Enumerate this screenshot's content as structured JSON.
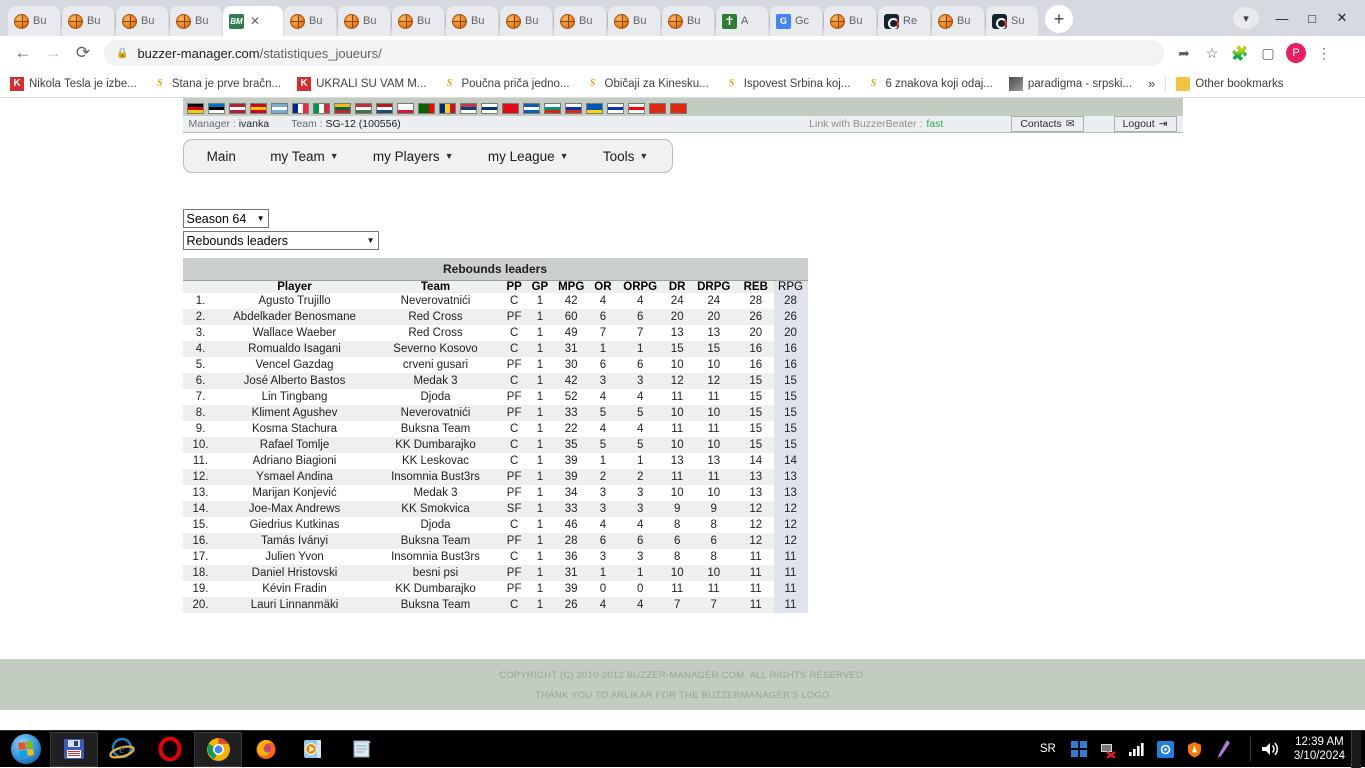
{
  "browser": {
    "tabs": [
      {
        "label": "Bu",
        "icon": "basketball-icon",
        "active": false
      },
      {
        "label": "Bu",
        "icon": "basketball-icon",
        "active": false
      },
      {
        "label": "Bu",
        "icon": "basketball-icon",
        "active": false
      },
      {
        "label": "Bu",
        "icon": "basketball-icon",
        "active": false
      },
      {
        "label": "",
        "icon": "bm-logo-icon",
        "active": true
      },
      {
        "label": "Bu",
        "icon": "basketball-icon",
        "active": false
      },
      {
        "label": "Bu",
        "icon": "basketball-icon",
        "active": false
      },
      {
        "label": "Bu",
        "icon": "basketball-icon",
        "active": false
      },
      {
        "label": "Bu",
        "icon": "basketball-icon",
        "active": false
      },
      {
        "label": "Bu",
        "icon": "basketball-icon",
        "active": false
      },
      {
        "label": "Bu",
        "icon": "basketball-icon",
        "active": false
      },
      {
        "label": "Bu",
        "icon": "basketball-icon",
        "active": false
      },
      {
        "label": "Bu",
        "icon": "basketball-icon",
        "active": false
      },
      {
        "label": "A",
        "icon": "google-translate-icon",
        "active": false
      },
      {
        "label": "Gc",
        "icon": "google-docs-icon",
        "active": false
      },
      {
        "label": "Bu",
        "icon": "basketball-icon",
        "active": false
      },
      {
        "label": "Re",
        "icon": "dark-dial-icon",
        "active": false
      },
      {
        "label": "Bu",
        "icon": "basketball-icon",
        "active": false
      },
      {
        "label": "Su",
        "icon": "dark-dial-icon",
        "active": false
      }
    ],
    "new_tab_label": "+",
    "close_tab_label": "✕",
    "window_controls": {
      "minimize": "—",
      "maximize": "□",
      "close": "✕"
    },
    "nav": {
      "back": "←",
      "forward": "→",
      "reload": "⟳"
    },
    "omnibox": {
      "lock_icon": "lock-icon",
      "url_domain": "buzzer-manager.com",
      "url_path": "/statistiques_joueurs/"
    },
    "toolbar_icons": [
      "share-icon",
      "star-icon",
      "extensions-icon",
      "sidepanel-icon",
      "profile-avatar",
      "menu-icon"
    ],
    "avatar_letter": "P",
    "bookmarks": [
      {
        "label": "Nikola Tesla je izbe...",
        "icon": "kurir-icon"
      },
      {
        "label": "Stana je prve bračn...",
        "icon": "srbijadanas-icon"
      },
      {
        "label": "UKRALI SU VAM M...",
        "icon": "kurir-icon"
      },
      {
        "label": "Poučna priča jedno...",
        "icon": "srbijadanas-icon"
      },
      {
        "label": "Običaji za Kinesku...",
        "icon": "srbijadanas-icon"
      },
      {
        "label": "Ispovest Srbina koj...",
        "icon": "srbijadanas-icon"
      },
      {
        "label": "6 znakova koji odaj...",
        "icon": "srbijadanas-icon"
      },
      {
        "label": "paradigma - srpski...",
        "icon": "image-icon"
      }
    ],
    "bookmarks_overflow": "»",
    "other_bookmarks": {
      "label": "Other bookmarks",
      "icon": "folder-icon"
    }
  },
  "site": {
    "flags": [
      {
        "name": "germany",
        "colors": [
          "#000000",
          "#dd0000",
          "#ffce00"
        ],
        "dir": "h"
      },
      {
        "name": "estonia",
        "colors": [
          "#0072ce",
          "#000000",
          "#ffffff"
        ],
        "dir": "h"
      },
      {
        "name": "usa",
        "colors": [
          "#b22234",
          "#ffffff",
          "#b22234"
        ],
        "dir": "h"
      },
      {
        "name": "spain",
        "colors": [
          "#c60b1e",
          "#ffc400",
          "#c60b1e"
        ],
        "dir": "h"
      },
      {
        "name": "argentina",
        "colors": [
          "#74acdf",
          "#ffffff",
          "#74acdf"
        ],
        "dir": "h"
      },
      {
        "name": "france",
        "colors": [
          "#002395",
          "#ffffff",
          "#ed2939"
        ],
        "dir": "v"
      },
      {
        "name": "italy",
        "colors": [
          "#009246",
          "#ffffff",
          "#ce2b37"
        ],
        "dir": "v"
      },
      {
        "name": "lithuania",
        "colors": [
          "#fdb913",
          "#006a44",
          "#c1272d"
        ],
        "dir": "h"
      },
      {
        "name": "hungary",
        "colors": [
          "#ce2939",
          "#ffffff",
          "#477050"
        ],
        "dir": "h"
      },
      {
        "name": "netherlands",
        "colors": [
          "#ae1c28",
          "#ffffff",
          "#21468b"
        ],
        "dir": "h"
      },
      {
        "name": "poland",
        "colors": [
          "#ffffff",
          "#ffffff",
          "#dc143c"
        ],
        "dir": "h"
      },
      {
        "name": "portugal",
        "colors": [
          "#006600",
          "#006600",
          "#ff0000"
        ],
        "dir": "v"
      },
      {
        "name": "romania",
        "colors": [
          "#002b7f",
          "#fcd116",
          "#ce1126"
        ],
        "dir": "v"
      },
      {
        "name": "serbia",
        "colors": [
          "#c6363c",
          "#0c4076",
          "#ffffff"
        ],
        "dir": "h"
      },
      {
        "name": "finland",
        "colors": [
          "#ffffff",
          "#003580",
          "#ffffff"
        ],
        "dir": "h"
      },
      {
        "name": "turkey",
        "colors": [
          "#e30a17",
          "#e30a17",
          "#e30a17"
        ],
        "dir": "h"
      },
      {
        "name": "greece",
        "colors": [
          "#0d5eaf",
          "#ffffff",
          "#0d5eaf"
        ],
        "dir": "h"
      },
      {
        "name": "bulgaria",
        "colors": [
          "#ffffff",
          "#00966e",
          "#d62612"
        ],
        "dir": "h"
      },
      {
        "name": "russia",
        "colors": [
          "#ffffff",
          "#0039a6",
          "#d52b1e"
        ],
        "dir": "h"
      },
      {
        "name": "ukraine",
        "colors": [
          "#0057b7",
          "#0057b7",
          "#ffd700"
        ],
        "dir": "h"
      },
      {
        "name": "israel",
        "colors": [
          "#ffffff",
          "#0038b8",
          "#ffffff"
        ],
        "dir": "h"
      },
      {
        "name": "georgia",
        "colors": [
          "#ffffff",
          "#ff0000",
          "#ffffff"
        ],
        "dir": "h"
      },
      {
        "name": "china",
        "colors": [
          "#de2910",
          "#de2910",
          "#de2910"
        ],
        "dir": "h"
      },
      {
        "name": "china2",
        "colors": [
          "#de2910",
          "#de2910",
          "#de2910"
        ],
        "dir": "h"
      }
    ],
    "infobar": {
      "manager_label": "Manager :",
      "manager_name": "ivanka",
      "team_label": "Team :",
      "team_name": "SG-12 (100556)",
      "link_label": "Link with BuzzerBeater :",
      "link_value": "fast",
      "contacts_label": "Contacts",
      "contacts_icon": "envelope-icon",
      "logout_label": "Logout",
      "logout_icon": "logout-icon"
    },
    "nav_menu": [
      {
        "label": "Main",
        "has_arrow": false
      },
      {
        "label": "my Team",
        "has_arrow": true
      },
      {
        "label": "my Players",
        "has_arrow": true
      },
      {
        "label": "my League",
        "has_arrow": true
      },
      {
        "label": "Tools",
        "has_arrow": true
      }
    ],
    "arrow_glyph": "▼",
    "season_select": {
      "value": "Season 64"
    },
    "stat_select": {
      "value": "Rebounds leaders"
    },
    "footer": {
      "line1": "COPYRIGHT (C) 2010-2012 BUZZER-MANAGER.COM. ALL RIGHTS RESERVED.",
      "line2": "THANK YOU TO ARLIKAR FOR THE BUZZERMANAGER'S LOGO"
    }
  },
  "table": {
    "title": "Rebounds leaders",
    "columns": [
      "",
      "Player",
      "Team",
      "PP",
      "GP",
      "MPG",
      "OR",
      "ORPG",
      "DR",
      "DRPG",
      "REB",
      "RPG"
    ],
    "rows": [
      {
        "rank": "1.",
        "player": "Agusto Trujillo",
        "team": "Neverovatnići",
        "pp": "C",
        "gp": "1",
        "mpg": "42",
        "or": "4",
        "orpg": "4",
        "dr": "24",
        "drpg": "24",
        "reb": "28",
        "rpg": "28"
      },
      {
        "rank": "2.",
        "player": "Abdelkader Benosmane",
        "team": "Red Cross",
        "pp": "PF",
        "gp": "1",
        "mpg": "60",
        "or": "6",
        "orpg": "6",
        "dr": "20",
        "drpg": "20",
        "reb": "26",
        "rpg": "26"
      },
      {
        "rank": "3.",
        "player": "Wallace Waeber",
        "team": "Red Cross",
        "pp": "C",
        "gp": "1",
        "mpg": "49",
        "or": "7",
        "orpg": "7",
        "dr": "13",
        "drpg": "13",
        "reb": "20",
        "rpg": "20"
      },
      {
        "rank": "4.",
        "player": "Romualdo Isagani",
        "team": "Severno Kosovo",
        "pp": "C",
        "gp": "1",
        "mpg": "31",
        "or": "1",
        "orpg": "1",
        "dr": "15",
        "drpg": "15",
        "reb": "16",
        "rpg": "16"
      },
      {
        "rank": "5.",
        "player": "Vencel Gazdag",
        "team": "crveni gusari",
        "pp": "PF",
        "gp": "1",
        "mpg": "30",
        "or": "6",
        "orpg": "6",
        "dr": "10",
        "drpg": "10",
        "reb": "16",
        "rpg": "16"
      },
      {
        "rank": "6.",
        "player": "José Alberto Bastos",
        "team": "Medak 3",
        "pp": "C",
        "gp": "1",
        "mpg": "42",
        "or": "3",
        "orpg": "3",
        "dr": "12",
        "drpg": "12",
        "reb": "15",
        "rpg": "15"
      },
      {
        "rank": "7.",
        "player": "Lin Tingbang",
        "team": "Djoda",
        "pp": "PF",
        "gp": "1",
        "mpg": "52",
        "or": "4",
        "orpg": "4",
        "dr": "11",
        "drpg": "11",
        "reb": "15",
        "rpg": "15"
      },
      {
        "rank": "8.",
        "player": "Kliment Agushev",
        "team": "Neverovatnići",
        "pp": "PF",
        "gp": "1",
        "mpg": "33",
        "or": "5",
        "orpg": "5",
        "dr": "10",
        "drpg": "10",
        "reb": "15",
        "rpg": "15"
      },
      {
        "rank": "9.",
        "player": "Kosma Stachura",
        "team": "Buksna Team",
        "pp": "C",
        "gp": "1",
        "mpg": "22",
        "or": "4",
        "orpg": "4",
        "dr": "11",
        "drpg": "11",
        "reb": "15",
        "rpg": "15"
      },
      {
        "rank": "10.",
        "player": "Rafael Tomlje",
        "team": "KK Dumbarajko",
        "pp": "C",
        "gp": "1",
        "mpg": "35",
        "or": "5",
        "orpg": "5",
        "dr": "10",
        "drpg": "10",
        "reb": "15",
        "rpg": "15"
      },
      {
        "rank": "11.",
        "player": "Adriano Biagioni",
        "team": "KK Leskovac",
        "pp": "C",
        "gp": "1",
        "mpg": "39",
        "or": "1",
        "orpg": "1",
        "dr": "13",
        "drpg": "13",
        "reb": "14",
        "rpg": "14"
      },
      {
        "rank": "12.",
        "player": "Ysmael Andina",
        "team": "Insomnia Bust3rs",
        "pp": "PF",
        "gp": "1",
        "mpg": "39",
        "or": "2",
        "orpg": "2",
        "dr": "11",
        "drpg": "11",
        "reb": "13",
        "rpg": "13"
      },
      {
        "rank": "13.",
        "player": "Marijan Konjević",
        "team": "Medak 3",
        "pp": "PF",
        "gp": "1",
        "mpg": "34",
        "or": "3",
        "orpg": "3",
        "dr": "10",
        "drpg": "10",
        "reb": "13",
        "rpg": "13"
      },
      {
        "rank": "14.",
        "player": "Joe-Max Andrews",
        "team": "KK Smokvica",
        "pp": "SF",
        "gp": "1",
        "mpg": "33",
        "or": "3",
        "orpg": "3",
        "dr": "9",
        "drpg": "9",
        "reb": "12",
        "rpg": "12"
      },
      {
        "rank": "15.",
        "player": "Giedrius Kutkinas",
        "team": "Djoda",
        "pp": "C",
        "gp": "1",
        "mpg": "46",
        "or": "4",
        "orpg": "4",
        "dr": "8",
        "drpg": "8",
        "reb": "12",
        "rpg": "12"
      },
      {
        "rank": "16.",
        "player": "Tamás Iványi",
        "team": "Buksna Team",
        "pp": "PF",
        "gp": "1",
        "mpg": "28",
        "or": "6",
        "orpg": "6",
        "dr": "6",
        "drpg": "6",
        "reb": "12",
        "rpg": "12"
      },
      {
        "rank": "17.",
        "player": "Julien Yvon",
        "team": "Insomnia Bust3rs",
        "pp": "C",
        "gp": "1",
        "mpg": "36",
        "or": "3",
        "orpg": "3",
        "dr": "8",
        "drpg": "8",
        "reb": "11",
        "rpg": "11"
      },
      {
        "rank": "18.",
        "player": "Daniel Hristovski",
        "team": "besni psi",
        "pp": "PF",
        "gp": "1",
        "mpg": "31",
        "or": "1",
        "orpg": "1",
        "dr": "10",
        "drpg": "10",
        "reb": "11",
        "rpg": "11"
      },
      {
        "rank": "19.",
        "player": "Kévin Fradin",
        "team": "KK Dumbarajko",
        "pp": "PF",
        "gp": "1",
        "mpg": "39",
        "or": "0",
        "orpg": "0",
        "dr": "11",
        "drpg": "11",
        "reb": "11",
        "rpg": "11"
      },
      {
        "rank": "20.",
        "player": "Lauri Linnanmäki",
        "team": "Buksna Team",
        "pp": "C",
        "gp": "1",
        "mpg": "26",
        "or": "4",
        "orpg": "4",
        "dr": "7",
        "drpg": "7",
        "reb": "11",
        "rpg": "11"
      }
    ]
  },
  "taskbar": {
    "start_icon": "windows-start-icon",
    "items": [
      {
        "name": "save-floppy-icon",
        "active": true
      },
      {
        "name": "internet-explorer-icon",
        "active": false
      },
      {
        "name": "opera-icon",
        "active": false
      },
      {
        "name": "google-chrome-icon",
        "active": true
      },
      {
        "name": "firefox-icon",
        "active": false
      },
      {
        "name": "media-player-icon",
        "active": false
      },
      {
        "name": "notepad-icon",
        "active": false
      }
    ],
    "language": "SR",
    "tray_icons": [
      "windows-tiles-icon",
      "network-error-icon",
      "signal-bars-icon",
      "camera-icon",
      "avast-icon",
      "pen-icon",
      "volume-icon"
    ],
    "time": "12:39 AM",
    "date": "3/10/2024"
  }
}
